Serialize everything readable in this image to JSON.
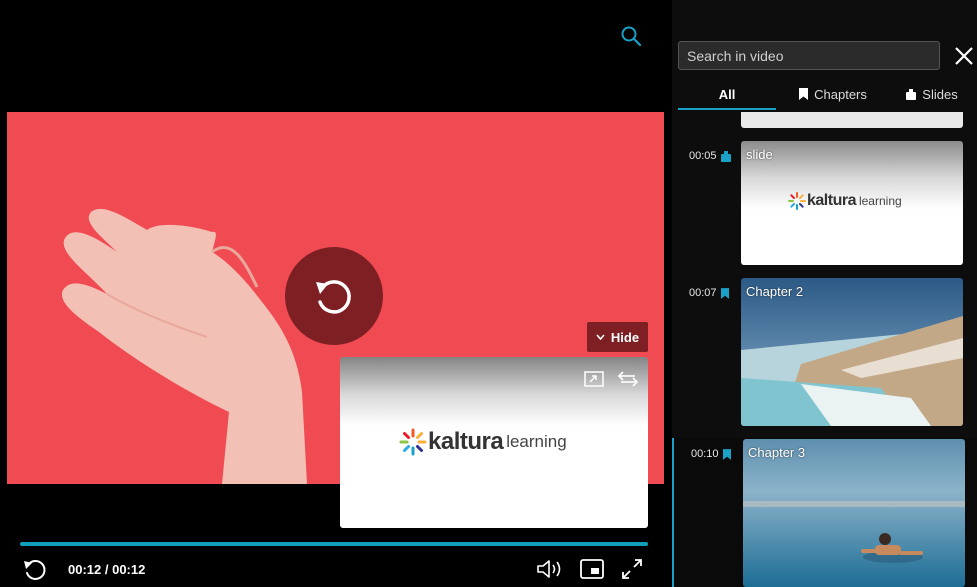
{
  "player": {
    "current_time": "00:12",
    "duration": "00:12",
    "progress": 1.0,
    "hide_label": "Hide",
    "pip_logo_word": "kaltura",
    "pip_logo_sub": "learning",
    "icons": [
      "search-icon",
      "replay-icon",
      "chevron-down-icon",
      "expand-icon",
      "swap-icon",
      "volume-icon",
      "picture-in-picture-icon",
      "fullscreen-icon"
    ]
  },
  "panel": {
    "search_placeholder": "Search in video",
    "tabs": [
      {
        "label": "All"
      },
      {
        "label": "Chapters"
      },
      {
        "label": "Slides"
      }
    ],
    "items": [
      {
        "time": "00:05",
        "type": "slide",
        "title": "slide",
        "logo_word": "kaltura",
        "logo_sub": "learning"
      },
      {
        "time": "00:07",
        "type": "chapter",
        "title": "Chapter 2"
      },
      {
        "time": "00:10",
        "type": "chapter",
        "title": "Chapter 3"
      }
    ]
  },
  "colors": {
    "accent": "#1aa1c7",
    "video_bg": "#f04a53",
    "dark_red": "#7e1f24"
  }
}
